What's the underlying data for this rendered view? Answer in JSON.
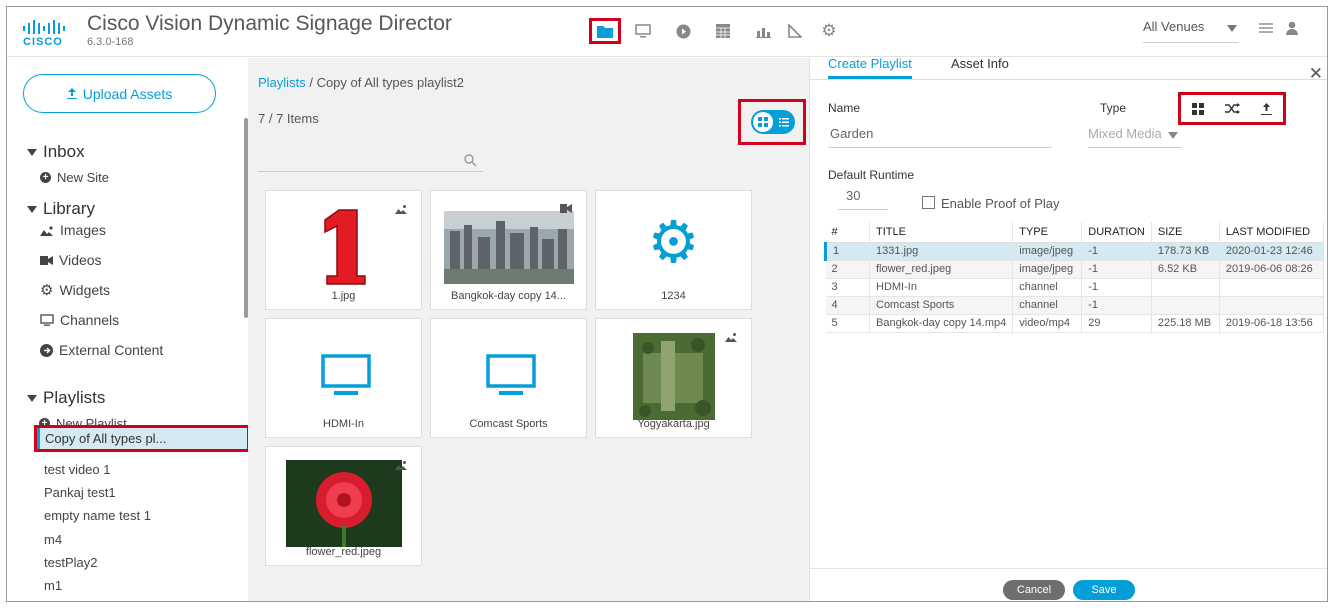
{
  "header": {
    "logo_text": "CISCO",
    "title": "Cisco Vision Dynamic Signage Director",
    "version": "6.3.0-168",
    "nav_icons": [
      "folder-icon",
      "monitor-icon",
      "play-icon",
      "calendar-icon",
      "bar-chart-icon",
      "triangle-ruler-icon",
      "gear-icon"
    ],
    "venue_select": "All Venues",
    "accent": "#049fd9",
    "highlight": "#d0021b"
  },
  "sidebar": {
    "upload_label": "Upload Assets",
    "inbox": {
      "title": "Inbox",
      "new_site": "New Site"
    },
    "library": {
      "title": "Library",
      "items": [
        "Images",
        "Videos",
        "Widgets",
        "Channels",
        "External Content"
      ]
    },
    "playlists": {
      "title": "Playlists",
      "new_playlist": "New Playlist",
      "selected": "Copy of All types pl...",
      "items": [
        "test video 1",
        "Pankaj test1",
        "empty name test 1",
        "m4",
        "testPlay2",
        "m1"
      ]
    }
  },
  "main": {
    "breadcrumb_link": "Playlists",
    "breadcrumb_sep": "/",
    "breadcrumb_current": "Copy of All types playlist2",
    "item_count": "7 / 7 Items",
    "tiles": [
      {
        "caption": "1.jpg"
      },
      {
        "caption": "Bangkok-day copy 14..."
      },
      {
        "caption": "1234"
      },
      {
        "caption": "HDMI-In"
      },
      {
        "caption": "Comcast Sports"
      },
      {
        "caption": "Yogyakarta.jpg"
      },
      {
        "caption": "flower_red.jpeg"
      }
    ]
  },
  "panel": {
    "tabs": [
      "Create Playlist",
      "Asset Info"
    ],
    "name_label": "Name",
    "name_value": "Garden",
    "type_label": "Type",
    "type_value": "Mixed Media",
    "runtime_label": "Default Runtime",
    "runtime_value": "30",
    "proof_label": "Enable Proof of Play",
    "columns": [
      "#",
      "TITLE",
      "TYPE",
      "DURATION",
      "SIZE",
      "LAST MODIFIED"
    ],
    "rows": [
      [
        "1",
        "1331.jpg",
        "image/jpeg",
        "-1",
        "178.73 KB",
        "2020-01-23 12:46"
      ],
      [
        "2",
        "flower_red.jpeg",
        "image/jpeg",
        "-1",
        "6.52 KB",
        "2019-06-06 08:26"
      ],
      [
        "3",
        "HDMI-In",
        "channel",
        "-1",
        "",
        ""
      ],
      [
        "4",
        "Comcast Sports",
        "channel",
        "-1",
        "",
        ""
      ],
      [
        "5",
        "Bangkok-day copy 14.mp4",
        "video/mp4",
        "29",
        "225.18 MB",
        "2019-06-18 13:56"
      ]
    ],
    "cancel_label": "Cancel",
    "save_label": "Save"
  }
}
